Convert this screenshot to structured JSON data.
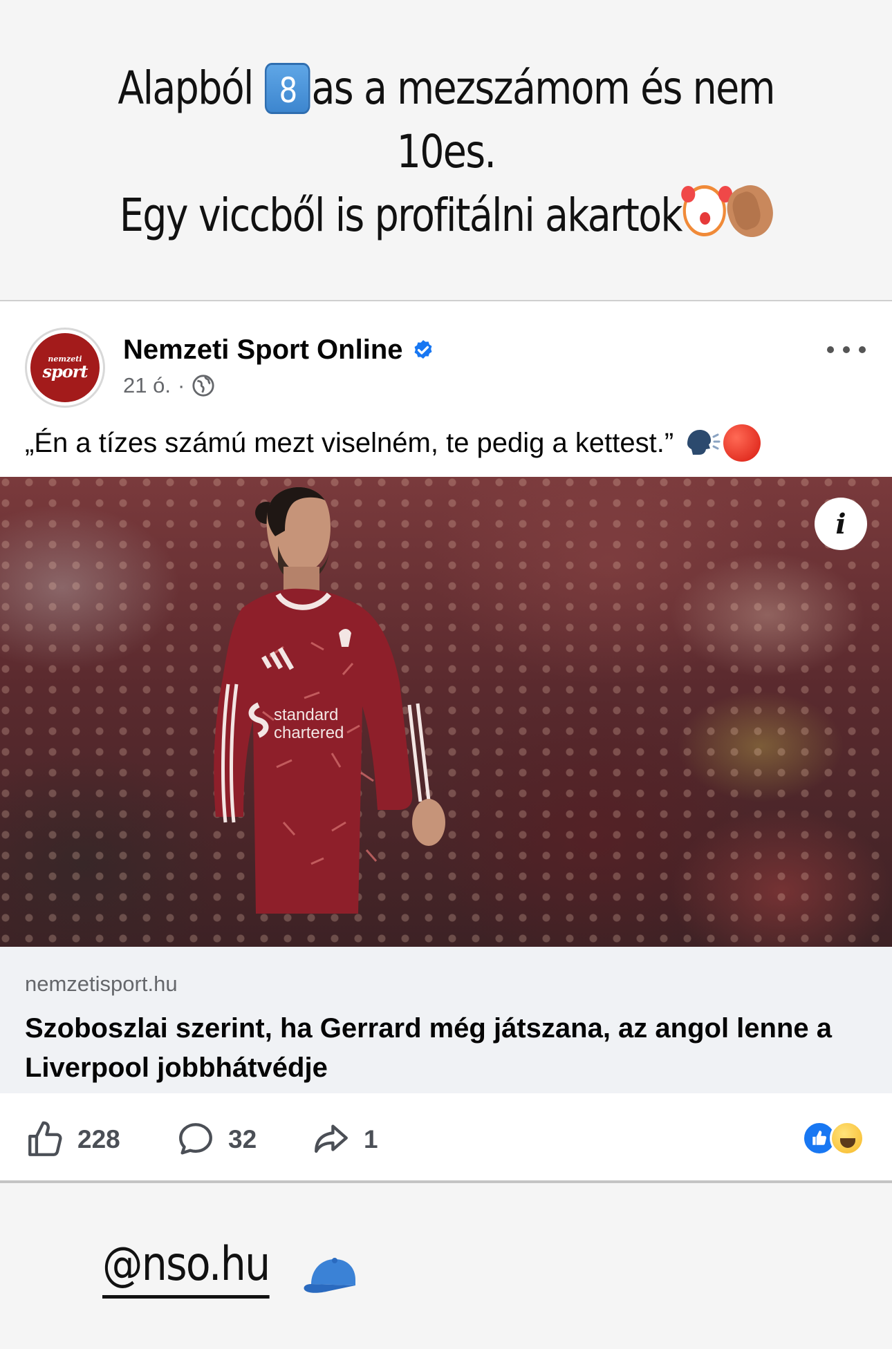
{
  "story": {
    "line1_before": "Alapból ",
    "keycap": "8",
    "line1_after": "as a mezszámom és nem",
    "line2": "10es.",
    "line3": "Egy viccből is profitálni akartok",
    "emojis": [
      "keycap-eight",
      "clown-face",
      "clapping-hands"
    ]
  },
  "post": {
    "page_name": "Nemzeti Sport Online",
    "avatar_text_top": "nemzeti",
    "avatar_text_bottom": "sport",
    "time": "21 ó.",
    "separator": "·",
    "text": "„Én a tízes számú mezt viselném, te pedig a kettest.”",
    "text_emojis": [
      "speaking-head",
      "red-circle"
    ],
    "photo_badge": "i",
    "jersey_text": "standard chartered",
    "link": {
      "domain": "nemzetisport.hu",
      "title": "Szoboszlai szerint, ha Gerrard még játszana, az angol lenne a Liverpool jobbhátvédje"
    },
    "actions": {
      "likes": "228",
      "comments": "32",
      "shares": "1"
    },
    "reactions": [
      "like",
      "haha"
    ]
  },
  "mention": "@nso.hu",
  "colors": {
    "verified": "#1877f2",
    "avatar_bg": "#a31b1b",
    "link_bg": "#f0f2f5",
    "jersey": "#8e1f2a"
  }
}
